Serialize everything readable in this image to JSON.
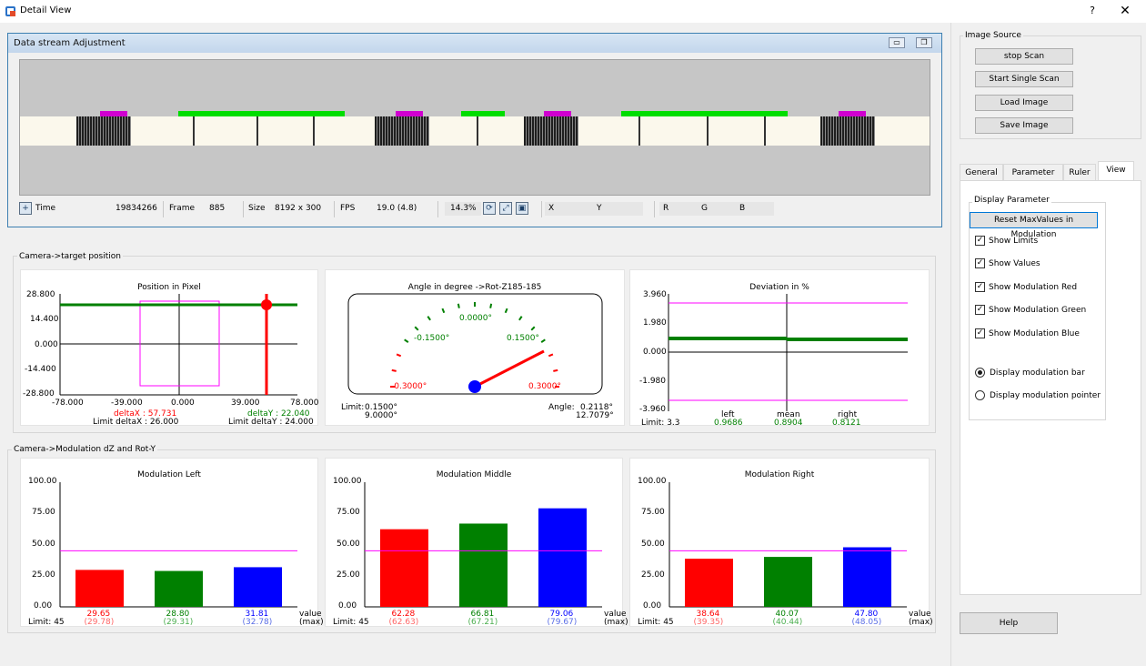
{
  "window": {
    "title": "Detail View",
    "help_glyph": "?",
    "close_glyph": "✕"
  },
  "stream": {
    "title": "Data stream Adjustment",
    "status": {
      "time_label": "Time",
      "time_value": "19834266",
      "frame_label": "Frame",
      "frame_value": "885",
      "size_label": "Size",
      "size_value": "8192 x 300",
      "fps_label": "FPS",
      "fps_value": "19.0 (4.8)",
      "zoom": "14.3%",
      "x_label": "X",
      "y_label": "Y",
      "r_label": "R",
      "g_label": "G",
      "b_label": "B"
    }
  },
  "target": {
    "group_title": "Camera->target position",
    "position": {
      "title": "Position in Pixel",
      "y_ticks": [
        "28.800",
        "14.400",
        "0.000",
        "-14.400",
        "-28.800"
      ],
      "x_ticks": [
        "-78.000",
        "-39.000",
        "0.000",
        "39.000",
        "78.000"
      ],
      "delta_x": "deltaX : 57.731",
      "delta_y": "deltaY : 22.040",
      "limit_x": "Limit deltaX : 26.000",
      "limit_y": "Limit deltaY : 24.000"
    },
    "angle": {
      "title": "Angle in degree ->Rot-Z185-185",
      "scale_top": "0.0000°",
      "scale_left_mid": "-0.1500°",
      "scale_right_mid": "0.1500°",
      "scale_left_end": "-0.3000°",
      "scale_right_end": "0.3000°",
      "limit_label": "Limit:",
      "limit_1": "0.1500°",
      "limit_2": "9.0000°",
      "angle_label": "Angle:",
      "angle_1": "0.2118°",
      "angle_2": "12.7079°"
    },
    "deviation": {
      "title": "Deviation in %",
      "y_ticks": [
        "3.960",
        "1.980",
        "0.000",
        "-1.980",
        "-3.960"
      ],
      "left_label": "left",
      "mean_label": "mean",
      "right_label": "right",
      "left_value": "0.9686",
      "mean_value": "0.8904",
      "right_value": "0.8121",
      "limit": "Limit: 3.3"
    }
  },
  "modulation": {
    "group_title": "Camera->Modulation dZ and Rot-Y",
    "y_ticks": [
      "100.00",
      "75.00",
      "50.00",
      "25.00",
      "0.00"
    ],
    "value_label": "value",
    "max_label": "(max)",
    "limit": "Limit: 45",
    "colors": {
      "red": "#ff0000",
      "green": "#008000",
      "blue": "#0000ff",
      "limit_line": "#ff00ff"
    }
  },
  "chart_data": [
    {
      "type": "bar",
      "title": "Modulation Left",
      "categories": [
        "Red",
        "Green",
        "Blue"
      ],
      "values": [
        29.65,
        28.8,
        31.81
      ],
      "max_values": [
        29.78,
        29.31,
        32.78
      ],
      "value_labels": [
        "29.65",
        "28.80",
        "31.81"
      ],
      "max_labels": [
        "(29.78)",
        "(29.31)",
        "(32.78)"
      ],
      "limit": 45,
      "ylim": [
        0,
        100
      ]
    },
    {
      "type": "bar",
      "title": "Modulation Middle",
      "categories": [
        "Red",
        "Green",
        "Blue"
      ],
      "values": [
        62.28,
        66.81,
        79.06
      ],
      "max_values": [
        62.63,
        67.21,
        79.67
      ],
      "value_labels": [
        "62.28",
        "66.81",
        "79.06"
      ],
      "max_labels": [
        "(62.63)",
        "(67.21)",
        "(79.67)"
      ],
      "limit": 45,
      "ylim": [
        0,
        100
      ]
    },
    {
      "type": "bar",
      "title": "Modulation Right",
      "categories": [
        "Red",
        "Green",
        "Blue"
      ],
      "values": [
        38.64,
        40.07,
        47.8
      ],
      "max_values": [
        39.35,
        40.44,
        48.05
      ],
      "value_labels": [
        "38.64",
        "40.07",
        "47.80"
      ],
      "max_labels": [
        "(39.35)",
        "(40.44)",
        "(48.05)"
      ],
      "limit": 45,
      "ylim": [
        0,
        100
      ]
    }
  ],
  "sidebar": {
    "image_source_title": "Image Source",
    "buttons": [
      "stop Scan",
      "Start Single Scan",
      "Load Image",
      "Save Image"
    ],
    "tabs": [
      "General",
      "Parameter",
      "Ruler",
      "View"
    ],
    "active_tab": "View",
    "display_param_title": "Display Parameter",
    "reset_button": "Reset MaxValues in Modulation",
    "checkboxes": [
      "Show Limits",
      "Show Values",
      "Show Modulation Red",
      "Show Modulation Green",
      "Show Modulation Blue"
    ],
    "radios": [
      "Display modulation bar",
      "Display modulation pointer"
    ],
    "selected_radio": "Display modulation bar",
    "help_button": "Help"
  }
}
